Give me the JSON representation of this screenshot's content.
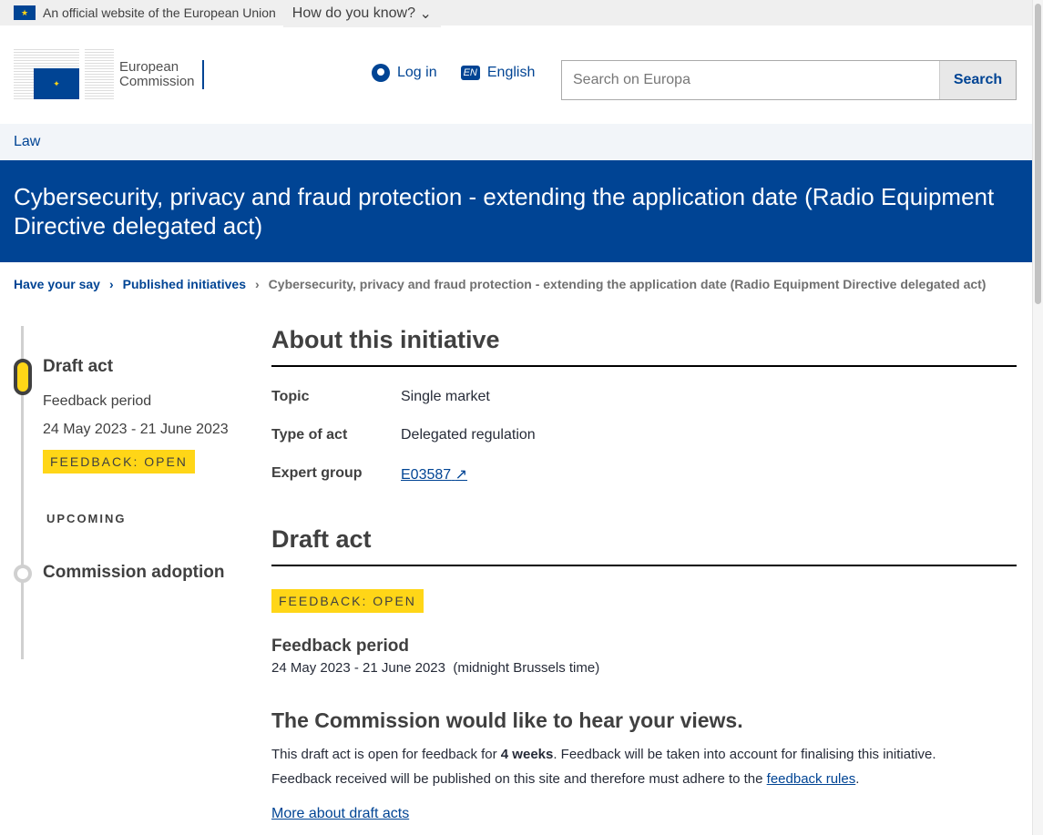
{
  "topbar": {
    "official": "An official website of the European Union",
    "how": "How do you know?"
  },
  "header": {
    "logo_line1": "European",
    "logo_line2": "Commission",
    "login": "Log in",
    "lang_code": "EN",
    "lang": "English",
    "search_placeholder": "Search on Europa",
    "search_button": "Search"
  },
  "site": "Law",
  "title": "Cybersecurity, privacy and fraud protection - extending the application date (Radio Equipment Directive delegated act)",
  "breadcrumb": [
    "Have your say",
    "Published initiatives",
    "Cybersecurity, privacy and fraud protection - extending the application date (Radio Equipment Directive delegated act)"
  ],
  "timeline": {
    "current_title": "Draft act",
    "current_sub": "Feedback period",
    "current_dates": "24 May 2023 - 21 June 2023",
    "badge": "FEEDBACK: OPEN",
    "upcoming": "UPCOMING",
    "next_title": "Commission adoption"
  },
  "about": {
    "heading": "About this initiative",
    "rows": [
      {
        "label": "Topic",
        "value": "Single market"
      },
      {
        "label": "Type of act",
        "value": "Delegated regulation"
      },
      {
        "label": "Expert group",
        "value": "E03587"
      }
    ]
  },
  "draft": {
    "heading": "Draft act",
    "badge": "FEEDBACK: OPEN",
    "period_title": "Feedback period",
    "period": "24 May 2023 - 21 June 2023",
    "period_note": "(midnight Brussels time)",
    "views_heading": "The Commission would like to hear your views.",
    "p1a": "This draft act is open for feedback for ",
    "p1b": "4 weeks",
    "p1c": ". Feedback will be taken into account for finalising this initiative.",
    "p2a": "Feedback received will be published on this site and therefore must adhere to the ",
    "p2link": "feedback rules",
    "p2b": ".",
    "more": "More about draft acts"
  },
  "colors": {
    "brand": "#004494",
    "badge": "#ffd617"
  }
}
